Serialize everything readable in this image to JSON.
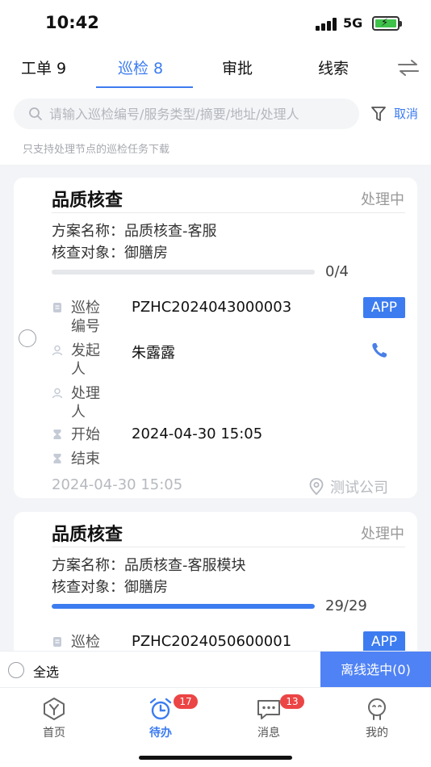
{
  "status": {
    "time": "10:42",
    "network": "5G"
  },
  "tabs": [
    {
      "label": "工单 9"
    },
    {
      "label": "巡检 8"
    },
    {
      "label": "审批"
    },
    {
      "label": "线索"
    }
  ],
  "search": {
    "placeholder": "请输入巡检编号/服务类型/摘要/地址/处理人",
    "cancel_label": "取消"
  },
  "notice": "只支持处理节点的巡检任务下载",
  "cards": [
    {
      "title": "品质核查",
      "status": "处理中",
      "scheme": "方案名称：品质核查-客服",
      "target": "核查对象：御膳房",
      "progress_text": "0/4",
      "progress_fraction": 0,
      "fields": {
        "inspection_no_label": "巡检编号",
        "inspection_no": "PZHC2024043000003",
        "initiator_label": "发起人",
        "initiator": "朱露露",
        "handler_label": "处理人",
        "handler": "",
        "start_label": "开始",
        "start": "2024-04-30 15:05",
        "end_label": "结束",
        "end": ""
      },
      "app_badge": "APP",
      "footer_date": "2024-04-30 15:05",
      "company": "测试公司"
    },
    {
      "title": "品质核查",
      "status": "处理中",
      "scheme": "方案名称：品质核查-客服模块",
      "target": "核查对象：御膳房",
      "progress_text": "29/29",
      "progress_fraction": 1,
      "fields": {
        "inspection_no_label": "巡检",
        "inspection_no": "PZHC2024050600001"
      },
      "app_badge": "APP"
    }
  ],
  "bottom": {
    "select_all_label": "全选",
    "offline_button": "离线选中(0)"
  },
  "tabbar": [
    {
      "label": "首页",
      "icon": "home-y-icon"
    },
    {
      "label": "待办",
      "icon": "alarm-clock-icon",
      "badge": "17"
    },
    {
      "label": "消息",
      "icon": "message-icon",
      "badge": "13"
    },
    {
      "label": "我的",
      "icon": "profile-icon"
    }
  ],
  "colors": {
    "accent": "#3c7cf0",
    "badge": "#ec4545",
    "button": "#4f82f5"
  }
}
